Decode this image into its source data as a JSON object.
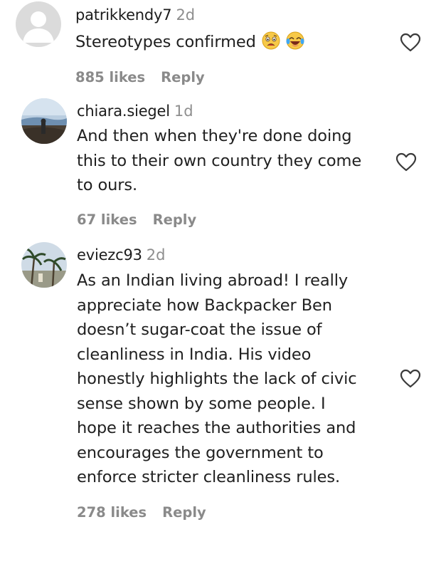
{
  "comments": [
    {
      "username": "patrikkendy7",
      "time": "2d",
      "lines": [
        "Stereotypes confirmed"
      ],
      "emojis": [
        "anxious-face-emoji",
        "face-with-tears-of-joy-emoji"
      ],
      "likes": "885 likes",
      "reply": "Reply",
      "avatar": "default-avatar"
    },
    {
      "username": "chiara.siegel",
      "time": "1d",
      "lines": [
        "And then when they're done doing",
        "this to their own country they come",
        "to ours."
      ],
      "likes": "67 likes",
      "reply": "Reply",
      "avatar": "landscape-photo-avatar"
    },
    {
      "username": "eviezc93",
      "time": "2d",
      "lines": [
        "As an Indian living abroad! I really",
        "appreciate how Backpacker Ben",
        "doesn’t sugar-coat the issue of",
        "cleanliness in India. His video",
        "honestly highlights the lack of civic",
        "sense shown by some people. I",
        "hope it reaches the authorities and",
        "encourages the government to",
        "enforce stricter cleanliness rules."
      ],
      "likes": "278 likes",
      "reply": "Reply",
      "avatar": "palm-tree-photo-avatar"
    }
  ],
  "colors": {
    "text": "#202020",
    "muted": "#8e8e8e",
    "heart_stroke": "#3a3a3a"
  }
}
